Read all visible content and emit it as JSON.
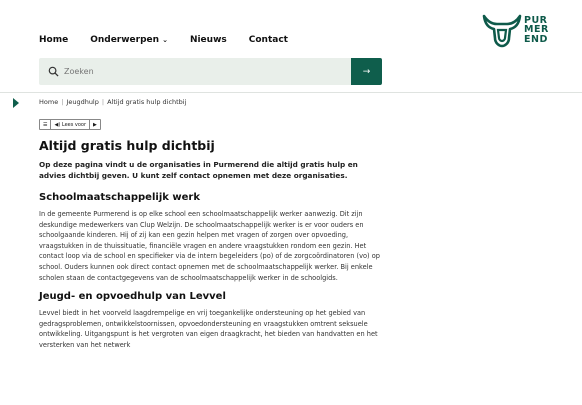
{
  "nav": {
    "items": [
      {
        "label": "Home"
      },
      {
        "label": "Onderwerpen",
        "chevron": "⌄"
      },
      {
        "label": "Nieuws"
      },
      {
        "label": "Contact"
      }
    ]
  },
  "logo": {
    "line1": "PUR",
    "line2": "MER",
    "line3": "END"
  },
  "search": {
    "placeholder": "Zoeken",
    "button_icon": "→"
  },
  "breadcrumb": {
    "items": [
      "Home",
      "Jeugdhulp",
      "Altijd gratis hulp dichtbij"
    ],
    "separator": "|"
  },
  "readspeaker": {
    "menu_icon": "☰",
    "label": "◀) Lees voor",
    "play_icon": "▶"
  },
  "content": {
    "title": "Altijd gratis hulp dichtbij",
    "intro": "Op deze pagina vindt u de organisaties in Purmerend die altijd gratis hulp en advies dichtbij geven. U kunt zelf contact opnemen met deze organisaties.",
    "sections": [
      {
        "heading": "Schoolmaatschappelijk werk",
        "text": "In de gemeente Purmerend is op elke school een schoolmaatschappelijk werker aanwezig. Dit zijn deskundige medewerkers van Clup Welzijn. De schoolmaatschappelijk werker is er voor ouders en schoolgaande kinderen. Hij of zij kan een gezin helpen met vragen of zorgen over opvoeding, vraagstukken in de thuissituatie, financiële vragen en andere vraagstukken rondom een gezin. Het contact loop via de school en specifieker via de intern begeleiders (po) of de zorgcoördinatoren (vo) op school. Ouders kunnen ook direct contact opnemen met de schoolmaatschappelijk werker. Bij enkele scholen staan de contactgegevens van de schoolmaatschappelijk werker in de schoolgids."
      },
      {
        "heading": "Jeugd- en opvoedhulp van Levvel",
        "text": "Levvel biedt in het voorveld laagdrempelige en vrij toegankelijke ondersteuning op het gebied van gedragsproblemen, ontwikkelstoornissen, opvoedondersteuning en vraagstukken omtrent seksuele ontwikkeling. Uitgangspunt is het vergroten van eigen draagkracht, het bieden van handvatten en het versterken van het netwerk"
      }
    ]
  },
  "colors": {
    "brand": "#0f5e4c",
    "search_bg": "#e9efea"
  }
}
